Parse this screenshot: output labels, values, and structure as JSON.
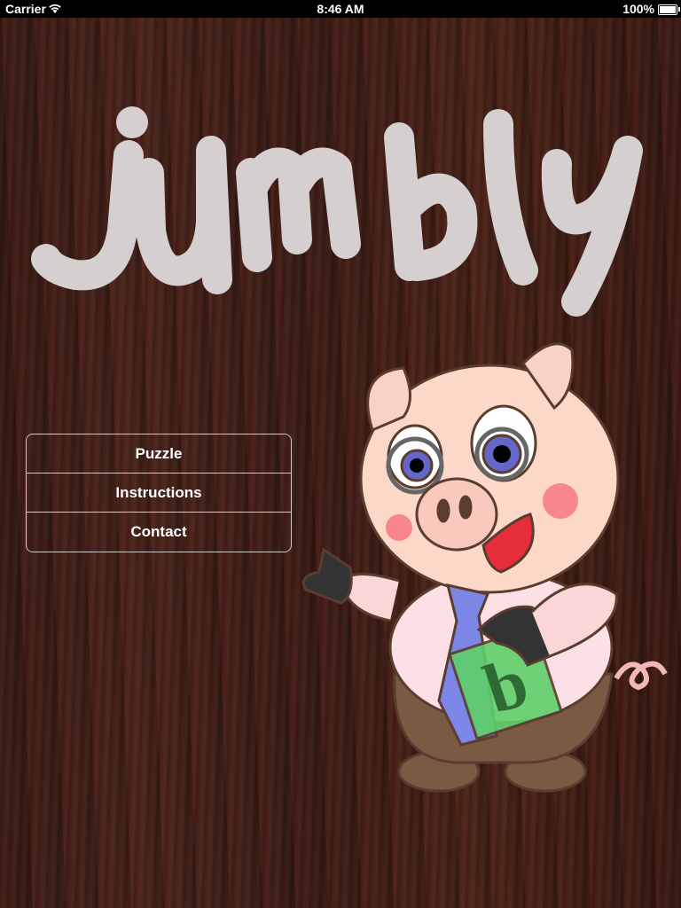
{
  "status_bar": {
    "carrier": "Carrier",
    "time": "8:46 AM",
    "battery": "100%"
  },
  "logo": {
    "text": "jumbly",
    "color": "#d5cfcf"
  },
  "menu": {
    "items": [
      {
        "label": "Puzzle"
      },
      {
        "label": "Instructions"
      },
      {
        "label": "Contact"
      }
    ]
  },
  "mascot": {
    "block_letter": "b"
  },
  "colors": {
    "wood": "#3f1f18",
    "menu_border": "#d0c8c6",
    "menu_text": "#ffffff",
    "pig_skin": "#f9d2c6",
    "tie": "#7b86e6",
    "block": "#5fd06a"
  }
}
